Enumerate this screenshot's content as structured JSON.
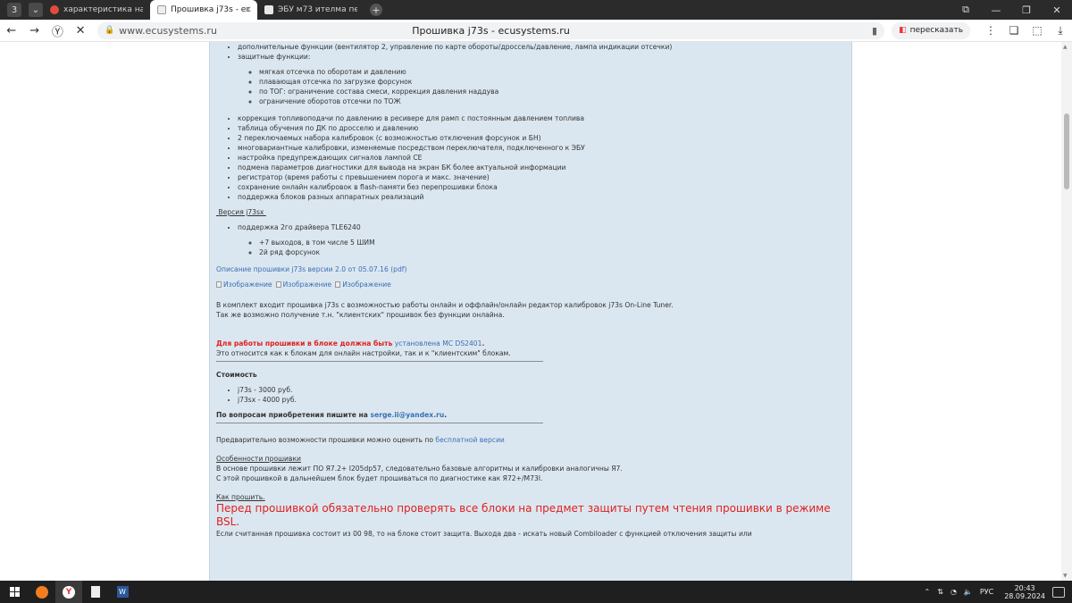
{
  "browser": {
    "tabs": [
      {
        "label": "характеристика наклон ",
        "active": false
      },
      {
        "label": "Прошивка j73s - ecusy",
        "active": true
      },
      {
        "label": "ЭБУ м73 ителма переход",
        "active": false
      }
    ],
    "new_tab": "+",
    "window_controls": [
      "⧉",
      "—",
      "❐",
      "✕"
    ],
    "url_domain": "www.ecusystems.ru",
    "page_title": "Прошивка j73s - ecusystems.ru",
    "retell_label": "пересказать"
  },
  "content": {
    "top_items": [
      "дополнительные функции (вентилятор 2, управление по карте обороты/дроссель/давление, лампа индикации отсечки)",
      "защитные функции:"
    ],
    "protection_items": [
      "мягкая отсечка по оборотам и давлению",
      "плавающая отсечка по загрузке форсунок",
      "по ТОГ: ограничение состава смеси, коррекция давления наддува",
      "ограничение оборотов отсечки по ТОЖ"
    ],
    "more_items": [
      "коррекция топливоподачи по давлению в ресивере для рамп с постоянным давлением топлива",
      "таблица обучения по ДК по дросселю и давлению",
      "2 переключаемых набора калибровок (с возможностью отключения форсунок и БН)",
      "многовариантные калибровки, изменяемые посредством переключателя, подключенного к ЭБУ",
      "настройка предупреждающих сигналов лампой CE",
      "подмена параметров диагностики для вывода на экран БК более актуальной информации",
      "регистратор (время работы с превышением порога и макс. значение)",
      "сохранение онлайн калибровок в flash-памяти без перепрошивки блока",
      "поддержка блоков разных аппаратных реализаций"
    ],
    "version_heading": " Версия j73sx ",
    "version_items": [
      "поддержка 2го драйвера TLE6240"
    ],
    "version_sub_items": [
      "+7 выходов, в том числе 5 ШИМ",
      "2й ряд форсунок"
    ],
    "description_link": "Описание прошивки j73s версии 2.0 от 05.07.16 (pdf)",
    "image_placeholders": [
      "Изображение",
      "Изображение",
      "Изображение"
    ],
    "kit_text_1": "В комплект входит прошивка j73s с возможностью работы онлайн и оффлайн/онлайн редактор калибровок j73s On-Line Tuner.",
    "kit_text_2": "Так же возможно получение т.н. \"клиентских\" прошивок без функции онлайна.",
    "warning_red": "Для работы прошивки в блоке должна быть",
    "warning_link": "установлена МС DS2401",
    "warning_dot": ".",
    "warning_note": "Это относится как к блокам для онлайн настройки, так и к \"клиентским\" блокам.",
    "price_heading": "Стоимость",
    "prices": [
      "j73s - 3000 руб.",
      "j73sx - 4000 руб."
    ],
    "contact_text": "По вопросам приобретения пишите на",
    "contact_email": "serge.ii@yandex.ru",
    "contact_dot": ".",
    "preview_text": "Предварительно возможности прошивки можно оценить по",
    "preview_link": "бесплатной версии",
    "features_heading": "Особенности прошивки",
    "features_text_1": "В основе прошивки лежит ПО Я7.2+ I205dp57, следовательно базовые алгоритмы и калибровки аналогичны Я7.",
    "features_text_2": "С этой прошивкой в дальнейшем блок будет прошиваться по диагностике как Я72+/M73I.",
    "how_heading": "Как прошить.",
    "big_warning": "Перед прошивкой обязательно проверять все блоки на предмет защиты путем чтения прошивки в режиме BSL.",
    "bottom_text": "Если считанная прошивка состоит из 00 98, то на блоке стоит защита. Выхода два - искать новый Combiloader с функцией отключения защиты или"
  },
  "taskbar": {
    "tray_lang": "РУС",
    "clock_time": "20:43",
    "clock_date": "28.09.2024"
  },
  "colors": {
    "content_bg": "#dbe7f0",
    "link": "#3a6fb5",
    "warning": "#e02020"
  }
}
